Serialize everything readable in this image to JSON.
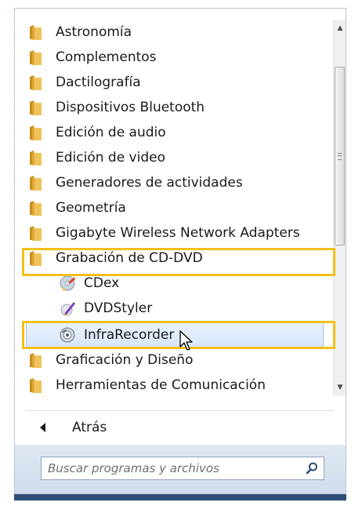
{
  "menu": {
    "folders_top": [
      {
        "label": "Astronomía"
      },
      {
        "label": "Complementos"
      },
      {
        "label": "Dactilografía"
      },
      {
        "label": "Dispositivos Bluetooth"
      },
      {
        "label": "Edición de audio"
      },
      {
        "label": "Edición de video"
      },
      {
        "label": "Generadores de actividades"
      },
      {
        "label": "Geometría"
      },
      {
        "label": "Gigabyte Wireless Network Adapters"
      },
      {
        "label": "Grabación de CD-DVD"
      }
    ],
    "subitems": [
      {
        "label": "CDex",
        "icon": "cdex-icon"
      },
      {
        "label": "DVDStyler",
        "icon": "dvdstyler-icon"
      },
      {
        "label": "InfraRecorder",
        "icon": "infrarecorder-icon"
      }
    ],
    "folders_bottom": [
      {
        "label": "Graficación y Diseño"
      },
      {
        "label": "Herramientas de Comunicación"
      }
    ]
  },
  "back": {
    "label": "Atrás"
  },
  "search": {
    "placeholder": "Buscar programas y archivos"
  },
  "colors": {
    "highlight": "#f3c01a",
    "selection": "#d7e7fa",
    "folder": "#e9b647"
  }
}
